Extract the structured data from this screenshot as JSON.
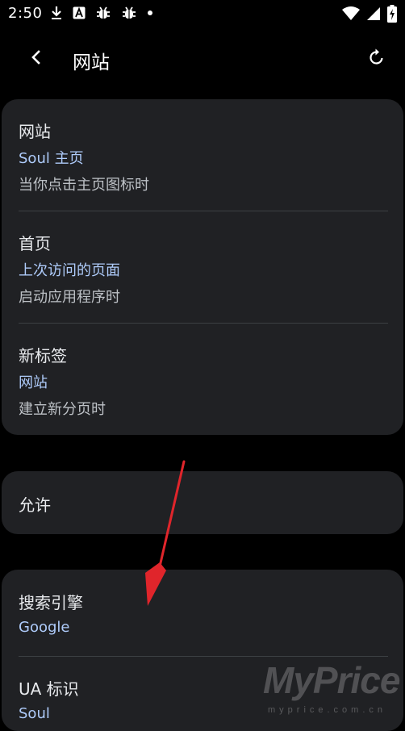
{
  "status_bar": {
    "time": "2:50",
    "left_icons": [
      "download-icon",
      "a-app-icon",
      "bug-icon",
      "bug-icon",
      "dot-icon"
    ],
    "right_icons": [
      "wifi-icon",
      "signal-icon",
      "battery-charging-icon"
    ]
  },
  "app_bar": {
    "title": "网站",
    "back_icon": "chevron-left-icon",
    "reset_icon": "refresh-icon"
  },
  "settings": {
    "website": {
      "title": "网站",
      "value": "Soul 主页",
      "summary": "当你点击主页图标时"
    },
    "home": {
      "title": "首页",
      "value": "上次访问的页面",
      "summary": "启动应用程序时"
    },
    "new_tab": {
      "title": "新标签",
      "value": "网站",
      "summary": "建立新分页时"
    },
    "allow": {
      "title": "允许"
    },
    "search_engine": {
      "title": "搜索引擎",
      "value": "Google"
    },
    "ua": {
      "title": "UA 标识",
      "value": "Soul"
    }
  },
  "watermark": {
    "brand": "MyPrice",
    "site": "myprice.com.cn"
  },
  "colors": {
    "background": "#000000",
    "card": "#202124",
    "accent_value": "#aecbfa",
    "annotation_arrow": "#e0252b"
  }
}
